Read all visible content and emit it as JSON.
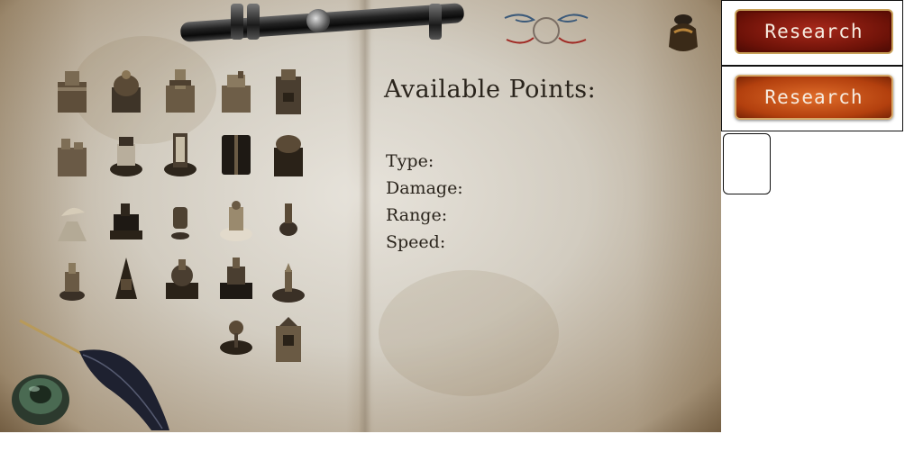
{
  "details": {
    "title": "Available Points:",
    "type_label": "Type:",
    "damage_label": "Damage:",
    "range_label": "Range:",
    "speed_label": "Speed:"
  },
  "research_buttons": [
    {
      "label": "Research",
      "state": "normal",
      "color": "#8e1c0e"
    },
    {
      "label": "Research",
      "state": "highlight",
      "color": "#c8561c"
    }
  ],
  "units": [
    {
      "name": "tower-1",
      "icon": "stone-tower-icon"
    },
    {
      "name": "tower-2",
      "icon": "dome-tower-icon"
    },
    {
      "name": "tower-3",
      "icon": "tall-tower-icon"
    },
    {
      "name": "tower-4",
      "icon": "fort-tower-icon"
    },
    {
      "name": "tower-5",
      "icon": "keep-tower-icon"
    },
    {
      "name": "tower-6",
      "icon": "ruined-tower-icon"
    },
    {
      "name": "tower-7",
      "icon": "machine-gun-icon"
    },
    {
      "name": "tower-8",
      "icon": "cannon-tower-icon"
    },
    {
      "name": "tower-9",
      "icon": "twin-bunker-icon"
    },
    {
      "name": "tower-10",
      "icon": "pillbox-icon"
    },
    {
      "name": "tower-11",
      "icon": "radar-dish-icon"
    },
    {
      "name": "tower-12",
      "icon": "gatling-icon"
    },
    {
      "name": "tower-13",
      "icon": "small-turret-icon"
    },
    {
      "name": "tower-14",
      "icon": "tesla-coil-icon"
    },
    {
      "name": "tower-15",
      "icon": "sentry-icon"
    },
    {
      "name": "tower-16",
      "icon": "mortar-icon"
    },
    {
      "name": "tower-17",
      "icon": "crane-icon"
    },
    {
      "name": "tower-18",
      "icon": "artillery-icon"
    },
    {
      "name": "tower-19",
      "icon": "heavy-artillery-icon"
    },
    {
      "name": "tower-20",
      "icon": "spike-turret-icon"
    },
    {
      "name": "tower-21",
      "icon": "fan-turret-icon"
    },
    {
      "name": "tower-22",
      "icon": "obelisk-tower-icon"
    }
  ]
}
